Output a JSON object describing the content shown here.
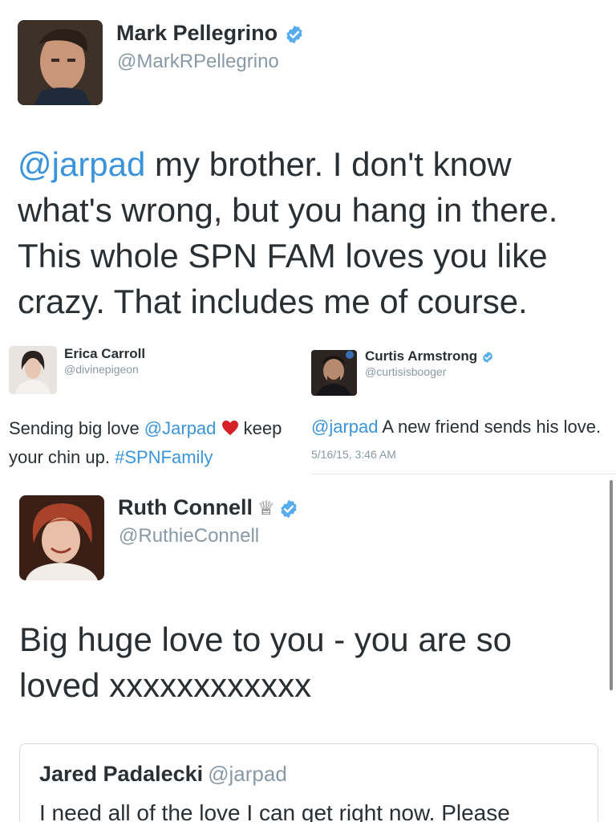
{
  "tweet_main": {
    "name": "Mark Pellegrino",
    "handle": "@MarkRPellegrino",
    "mention": "@jarpad",
    "text": " my brother. I don't know what's wrong, but you hang in there. This whole SPN FAM loves you like crazy. That includes me of course."
  },
  "tweet_erica": {
    "name": "Erica Carroll",
    "handle": "@divinepigeon",
    "text_before": "Sending big love ",
    "mention": "@Jarpad",
    "heart": "❤️",
    "text_middle": " keep your chin up. ",
    "hashtag": "#SPNFamily"
  },
  "tweet_curtis": {
    "name": "Curtis Armstrong",
    "handle": "@curtisisbooger",
    "mention": "@jarpad",
    "text": " A new friend sends his love.",
    "timestamp": "5/16/15, 3:46 AM"
  },
  "tweet_ruth": {
    "name": "Ruth Connell",
    "crown": "♕",
    "handle": "@RuthieConnell",
    "text": "Big huge love to you - you are so loved  xxxxxxxxxxxx"
  },
  "quoted_tweet": {
    "name": "Jared Padalecki",
    "handle": "@jarpad",
    "text": "I need all of the love I can get right now. Please"
  },
  "colors": {
    "link": "#3b94d9",
    "verified": "#55acee",
    "secondary_text": "#8899a6",
    "primary_text": "#292f33"
  }
}
